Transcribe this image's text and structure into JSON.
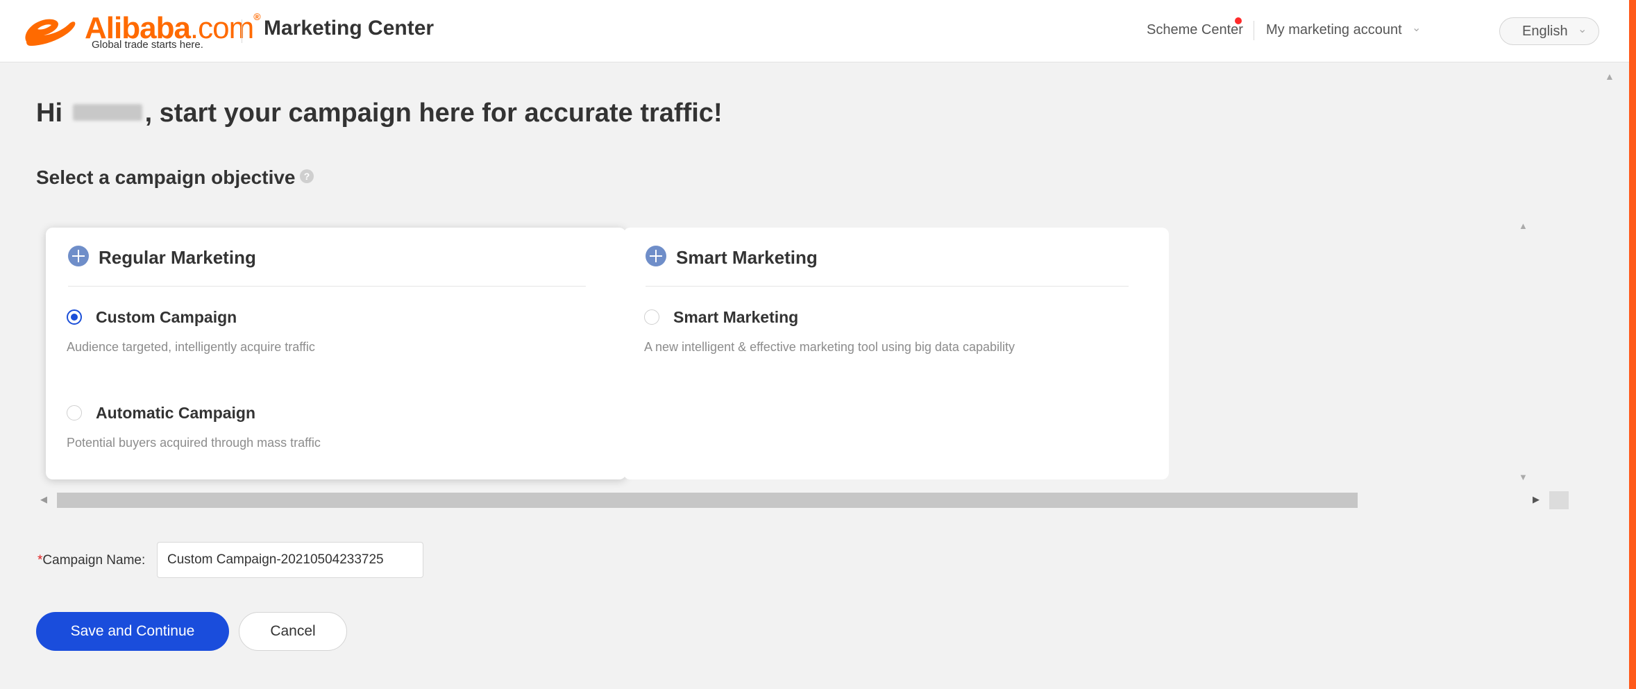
{
  "header": {
    "logo_brand": "Alibaba",
    "logo_tld": ".com",
    "logo_tagline": "Global trade starts here.",
    "title": "Marketing Center",
    "nav": {
      "scheme_center": "Scheme Center",
      "account": "My marketing account",
      "language": "English"
    }
  },
  "main": {
    "greeting_prefix": "Hi",
    "greeting_suffix": ", start your campaign here for accurate traffic!",
    "section_title": "Select a campaign objective",
    "cards": [
      {
        "title": "Regular Marketing",
        "options": [
          {
            "label": "Custom Campaign",
            "desc": "Audience targeted, intelligently acquire traffic",
            "selected": true
          },
          {
            "label": "Automatic Campaign",
            "desc": "Potential buyers acquired through mass traffic",
            "selected": false
          }
        ]
      },
      {
        "title": "Smart Marketing",
        "options": [
          {
            "label": "Smart Marketing",
            "desc": "A new intelligent & effective marketing tool using big data capability",
            "selected": false
          }
        ]
      }
    ],
    "campaign_name": {
      "required_mark": "*",
      "label": "Campaign Name:",
      "value": "Custom Campaign-20210504233725"
    },
    "buttons": {
      "save": "Save and Continue",
      "cancel": "Cancel"
    }
  },
  "colors": {
    "accent": "#1a4ddc",
    "brand": "#ff6a00",
    "frame": "#ff5a1a",
    "required": "#e02020"
  }
}
